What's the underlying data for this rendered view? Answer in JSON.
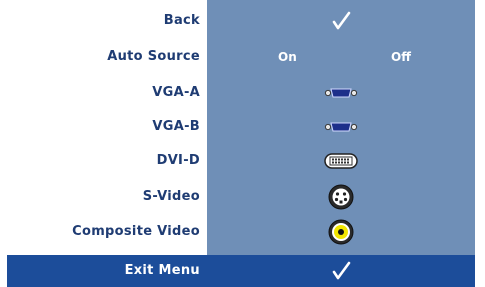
{
  "menu": {
    "back": {
      "label": "Back",
      "icon": "checkmark-icon"
    },
    "auto_source": {
      "label": "Auto Source",
      "on": "On",
      "off": "Off"
    },
    "vga_a": {
      "label": "VGA-A",
      "icon": "vga-port-icon"
    },
    "vga_b": {
      "label": "VGA-B",
      "icon": "vga-port-icon"
    },
    "dvi_d": {
      "label": "DVI-D",
      "icon": "dvi-port-icon"
    },
    "s_video": {
      "label": "S-Video",
      "icon": "s-video-port-icon"
    },
    "composite_video": {
      "label": "Composite Video",
      "icon": "composite-video-port-icon"
    },
    "exit": {
      "label": "Exit Menu",
      "icon": "checkmark-icon"
    }
  },
  "colors": {
    "panel": "#6f8fb7",
    "label_text": "#1f3c73",
    "highlight_bar": "#1c4d9a",
    "port_blue": "#1d2f8a",
    "rca_yellow": "#f2e600"
  }
}
